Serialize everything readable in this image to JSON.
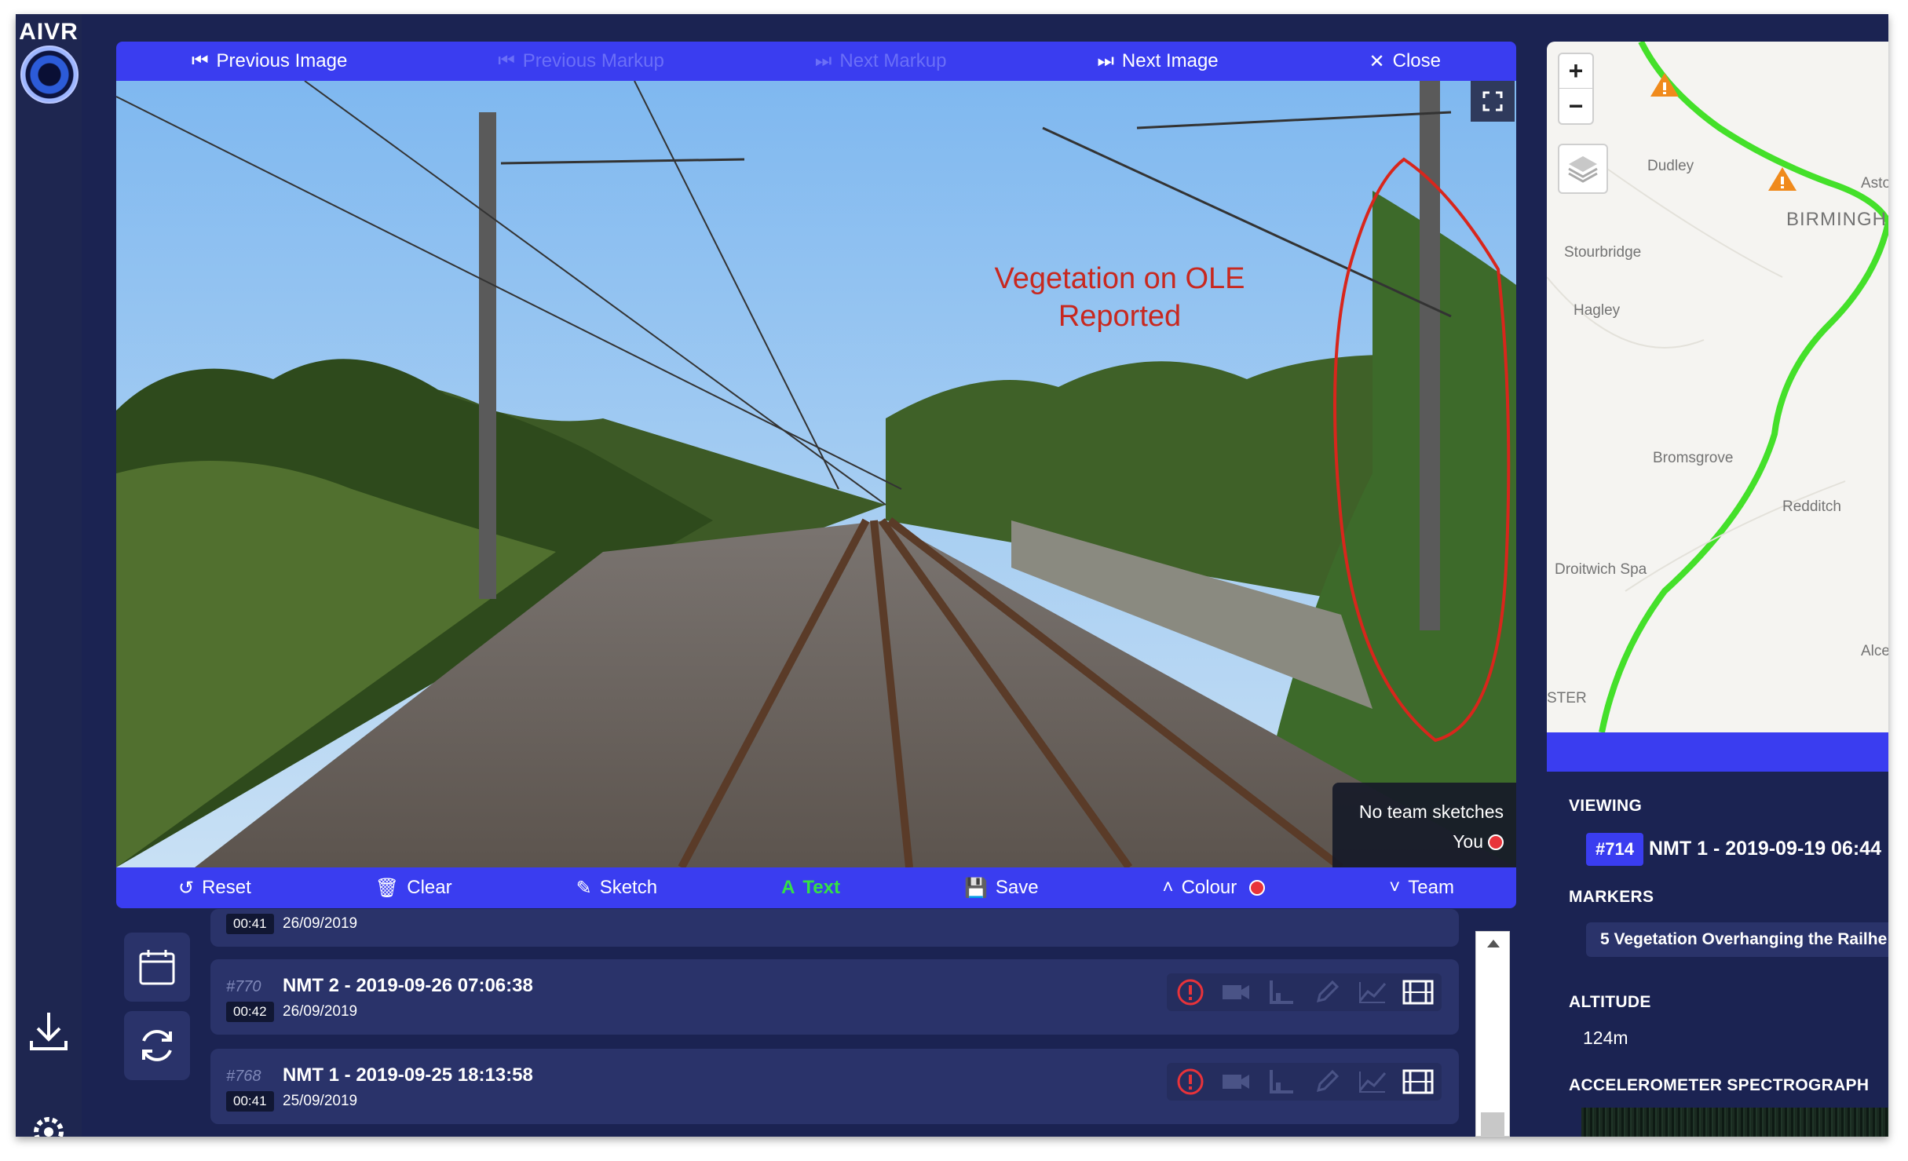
{
  "app": {
    "logo": "AIVR"
  },
  "nav": {
    "previous_image": "Previous Image",
    "previous_markup": "Previous Markup",
    "next_markup": "Next Markup",
    "next_image": "Next Image",
    "close": "Close"
  },
  "viewer": {
    "annotation_line1": "Vegetation on OLE",
    "annotation_line2": "Reported",
    "legend_team": "No team sketches",
    "legend_you": "You"
  },
  "toolbar": {
    "reset": "Reset",
    "clear": "Clear",
    "sketch": "Sketch",
    "text": "Text",
    "save": "Save",
    "colour": "Colour",
    "team": "Team"
  },
  "records": [
    {
      "id": "#770",
      "title": "NMT 2 - 2019-09-26 07:06:38",
      "duration": "00:42",
      "date": "26/09/2019"
    },
    {
      "id": "#768",
      "title": "NMT 1 - 2019-09-25 18:13:58",
      "duration": "00:41",
      "date": "25/09/2019"
    }
  ],
  "partial_record": {
    "duration": "00:41",
    "date": "26/09/2019"
  },
  "map": {
    "zoom_in": "+",
    "zoom_out": "−",
    "labels": [
      "Dudley",
      "Aston",
      "BIRMINGH",
      "Stourbridge",
      "Hagley",
      "Bromsgrove",
      "Redditch",
      "Droitwich Spa",
      "Alce",
      "STER"
    ]
  },
  "info": {
    "viewing_heading": "VIEWING",
    "viewing_id": "#714",
    "viewing_title": "NMT 1 - 2019-09-19 06:44",
    "markers_heading": "MARKERS",
    "marker_item": "5 Vegetation Overhanging the Railhe",
    "altitude_heading": "ALTITUDE",
    "altitude_value": "124m",
    "spectrograph_heading": "ACCELEROMETER SPECTROGRAPH"
  },
  "colors": {
    "accent": "#3a3df0",
    "panel": "#1b2352",
    "annotation": "#c8281f",
    "route": "#44e02a",
    "active_tool": "#34e046"
  }
}
